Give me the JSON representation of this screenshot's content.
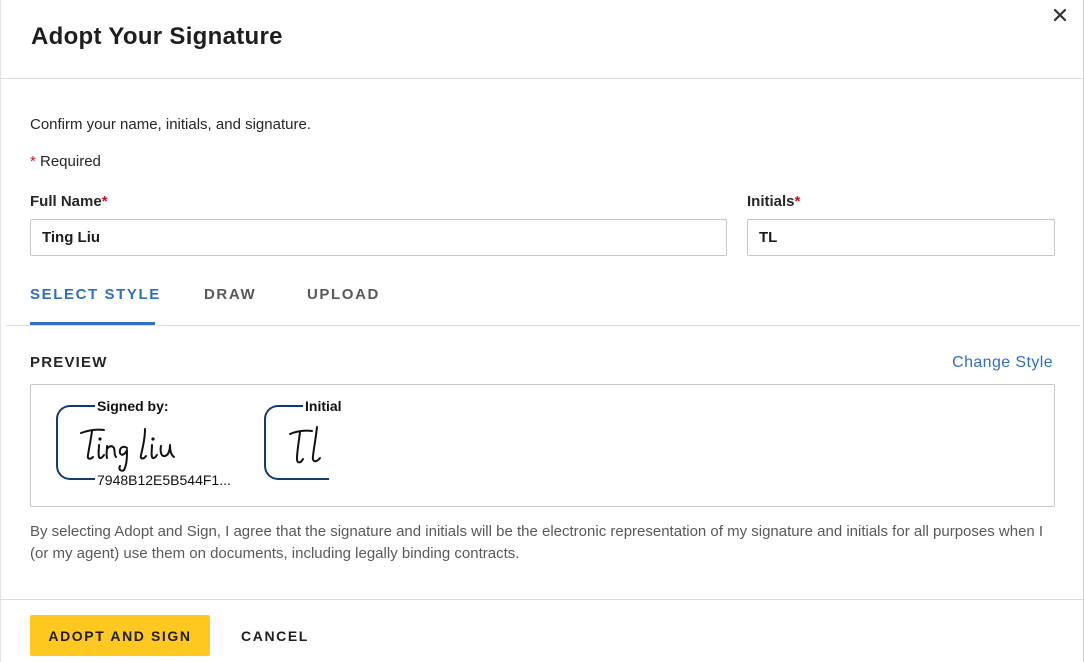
{
  "dialog": {
    "title": "Adopt Your Signature",
    "close_icon": "close-icon"
  },
  "form": {
    "instructions": "Confirm your name, initials, and signature.",
    "required_marker": "*",
    "required_text": " Required",
    "full_name": {
      "label": "Full Name",
      "marker": "*",
      "value": "Ting Liu"
    },
    "initials": {
      "label": "Initials",
      "marker": "*",
      "value": "TL"
    }
  },
  "tabs": [
    {
      "label": "SELECT STYLE",
      "active": true
    },
    {
      "label": "DRAW",
      "active": false
    },
    {
      "label": "UPLOAD",
      "active": false
    }
  ],
  "preview": {
    "label": "PREVIEW",
    "change_style": "Change Style",
    "signed_by": "Signed by:",
    "signature_script": "Ting Liu",
    "signature_id": "7948B12E5B544F1...",
    "initial_caption": "Initial",
    "initial_script": "TL"
  },
  "legal_text": "By selecting Adopt and Sign, I agree that the signature and initials will be the electronic representation of my signature and initials for all purposes when I (or my agent) use them on documents, including legally binding contracts.",
  "footer": {
    "adopt_label": "ADOPT AND SIGN",
    "cancel_label": "CANCEL"
  },
  "colors": {
    "accent": "#2f6fc0",
    "primary_button": "#ffc820",
    "required": "#c8102e",
    "signature_frame": "#113d6b"
  }
}
